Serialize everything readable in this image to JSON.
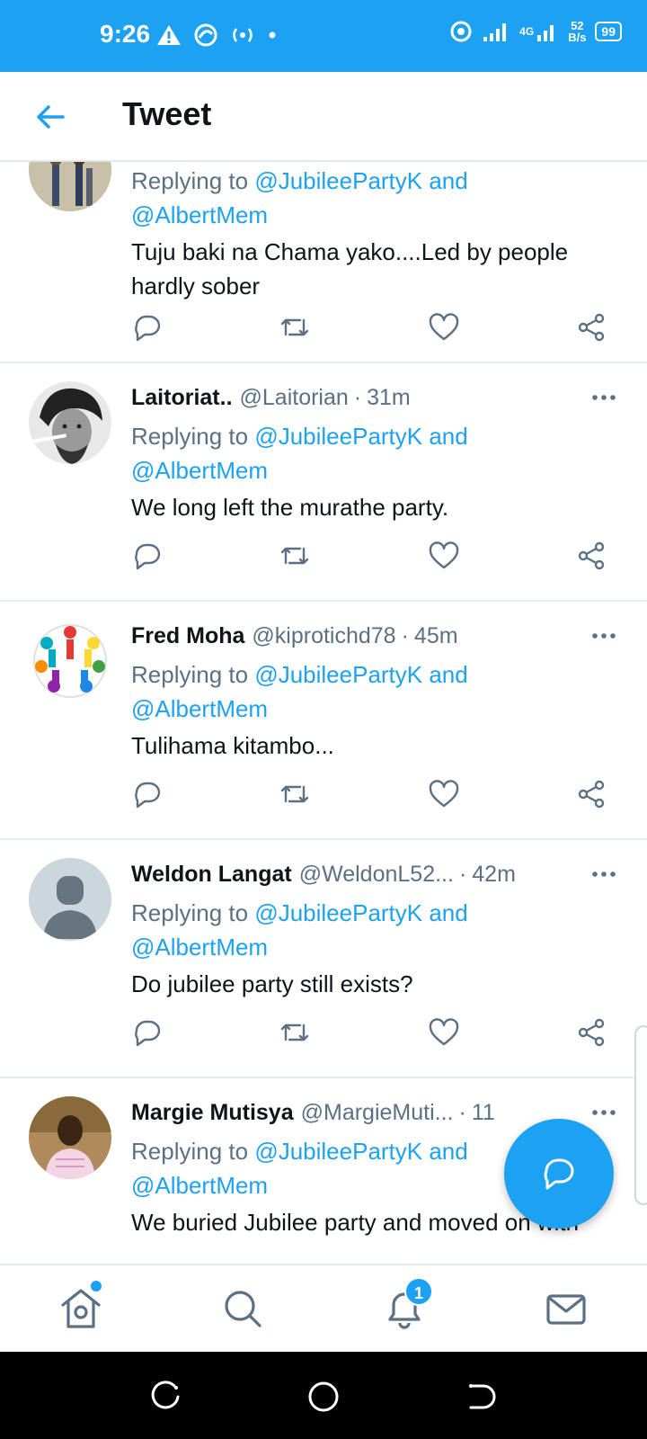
{
  "status_bar": {
    "time": "9:26",
    "network": "4G",
    "speed_value": "52",
    "speed_unit": "B/s",
    "battery": "99"
  },
  "header": {
    "title": "Tweet"
  },
  "tweets": [
    {
      "name": "",
      "handle": "",
      "time": "",
      "reply_prefix": "Replying to",
      "mention1": "@JubileePartyK and",
      "mention2": "@AlbertMem",
      "text": "Tuju baki na Chama yako....Led by people hardly sober"
    },
    {
      "name": "Laitoriat..",
      "handle": "@Laitorian",
      "time": "31m",
      "reply_prefix": "Replying to",
      "mention1": "@JubileePartyK and",
      "mention2": "@AlbertMem",
      "text": "We long left the murathe party."
    },
    {
      "name": "Fred Moha",
      "handle": "@kiprotichd78",
      "time": "45m",
      "reply_prefix": "Replying to",
      "mention1": "@JubileePartyK and",
      "mention2": "@AlbertMem",
      "text": "Tulihama kitambo..."
    },
    {
      "name": "Weldon Langat",
      "handle": "@WeldonL52...",
      "time": "42m",
      "reply_prefix": "Replying to",
      "mention1": "@JubileePartyK and",
      "mention2": "@AlbertMem",
      "text": "Do jubilee party still exists?"
    },
    {
      "name": "Margie Mutisya",
      "handle": "@MargieMuti...",
      "time": "11",
      "reply_prefix": "Replying to",
      "mention1": "@JubileePartyK and",
      "mention2": "@AlbertMem",
      "text": "We buried Jubilee party and moved on with"
    }
  ],
  "bottom_nav": {
    "notifications_badge": "1"
  },
  "colors": {
    "accent": "#1da1f2",
    "text": "#0f1419",
    "secondary": "#5b7083"
  },
  "icons": [
    "back-arrow-icon",
    "reply-icon",
    "retweet-icon",
    "like-icon",
    "share-icon",
    "more-icon",
    "compose-reply-icon",
    "home-icon",
    "search-icon",
    "notifications-icon",
    "messages-icon"
  ]
}
